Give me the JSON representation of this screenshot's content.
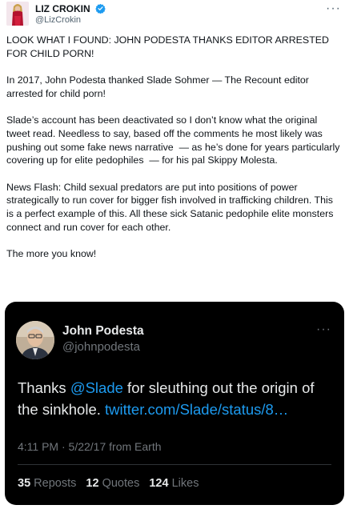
{
  "author": {
    "name": "LIZ CROKIN",
    "handle": "@LizCrokin"
  },
  "menu_glyph": "···",
  "paragraphs": [
    "LOOK WHAT I FOUND: JOHN PODESTA THANKS EDITOR ARRESTED FOR CHILD PORN!",
    "In 2017, John Podesta thanked Slade Sohmer — The Recount editor arrested for child porn!",
    "Slade’s account has been deactivated so I don’t know what the original tweet read. Needless to say, based off the comments he most likely was pushing out some fake news narrative  — as he’s done for years particularly covering up for elite pedophiles  — for his pal Skippy Molesta.",
    "News Flash: Child sexual predators are put into positions of power strategically to run cover for bigger fish involved in trafficking children. This is a perfect example of this. All these sick Satanic pedophile elite monsters connect and run cover for each other.",
    "The more you know!"
  ],
  "embedded": {
    "name": "John Podesta",
    "handle": "@johnpodesta",
    "text_before": "Thanks ",
    "mention": "@Slade",
    "text_middle": " for sleuthing out the origin of the sinkhole. ",
    "url": "twitter.com/Slade/status/8…",
    "meta": "4:11 PM · 5/22/17 from Earth",
    "reposts_count": "35",
    "reposts_label": "Reposts",
    "quotes_count": "12",
    "quotes_label": "Quotes",
    "likes_count": "124",
    "likes_label": "Likes"
  },
  "colors": {
    "link": "#1d9bf0",
    "verified": "#1d9bf0",
    "embed_bg": "#000000"
  }
}
